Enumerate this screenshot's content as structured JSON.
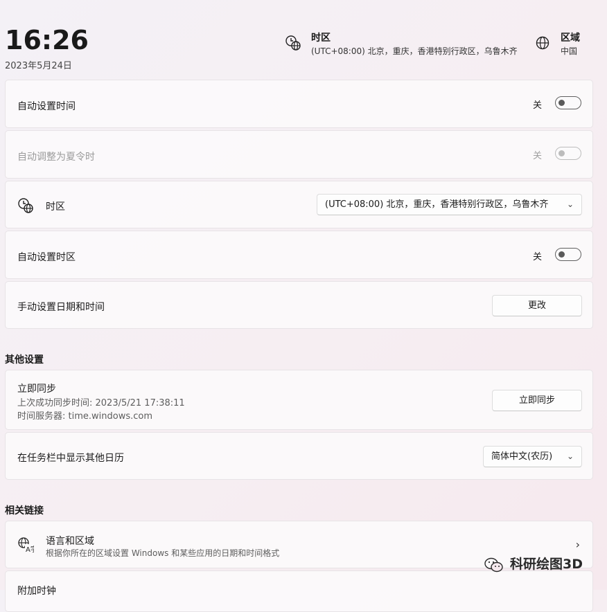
{
  "header": {
    "time": "16:26",
    "date": "2023年5月24日",
    "timezone": {
      "title": "时区",
      "value": "(UTC+08:00) 北京，重庆，香港特别行政区，乌鲁木齐",
      "icon": "clock-globe-icon"
    },
    "region": {
      "title": "区域",
      "value": "中国",
      "icon": "globe-icon"
    }
  },
  "settings": {
    "auto_time": {
      "label": "自动设置时间",
      "state": "关",
      "on": false
    },
    "dst": {
      "label": "自动调整为夏令时",
      "state": "关",
      "on": false,
      "disabled": true
    },
    "timezone": {
      "label": "时区",
      "selected": "(UTC+08:00) 北京，重庆，香港特别行政区，乌鲁木齐",
      "icon": "clock-globe-icon"
    },
    "auto_timezone": {
      "label": "自动设置时区",
      "state": "关",
      "on": false
    },
    "manual": {
      "label": "手动设置日期和时间",
      "button": "更改"
    }
  },
  "other": {
    "section_title": "其他设置",
    "sync": {
      "label": "立即同步",
      "last_sync": "上次成功同步时间: 2023/5/21 17:38:11",
      "server": "时间服务器: time.windows.com",
      "button": "立即同步"
    },
    "calendar": {
      "label": "在任务栏中显示其他日历",
      "selected": "简体中文(农历)"
    }
  },
  "related": {
    "section_title": "相关链接",
    "language": {
      "label": "语言和区域",
      "desc": "根据你所在的区域设置 Windows 和某些应用的日期和时间格式",
      "icon": "language-icon"
    },
    "extra_clock": {
      "label": "附加时钟"
    }
  },
  "watermark": {
    "text": "科研绘图3D",
    "icon": "wechat-icon"
  }
}
